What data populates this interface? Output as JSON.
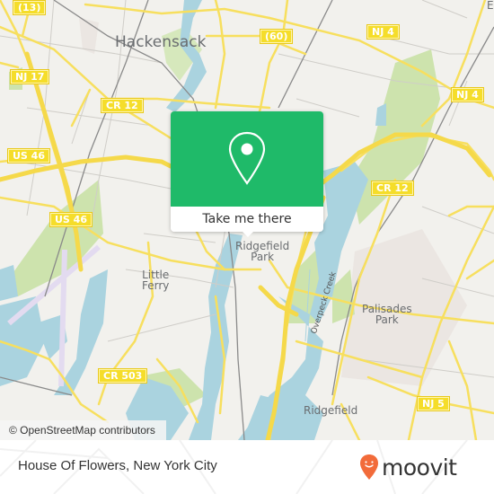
{
  "map": {
    "attribution": "© OpenStreetMap contributors",
    "colors": {
      "land": "#f2f1ed",
      "water": "#aad3df",
      "park": "#c8e0a8",
      "road_major": "#f7df5e",
      "road_minor": "#c9c7c2",
      "rail": "#888888",
      "airport": "#e6def0",
      "urban": "#e9e4e0"
    },
    "places": [
      {
        "name": "Hackensack"
      },
      {
        "name": "Little\nFerry"
      },
      {
        "name": "Ridgefield\nPark"
      },
      {
        "name": "Palisades\nPark"
      },
      {
        "name": "Ridgefield"
      },
      {
        "name": "E"
      }
    ],
    "waterway_label": "Overpeck Creek",
    "shields": [
      "(13)",
      "(60)",
      "NJ 4",
      "NJ 17",
      "CR 12",
      "NJ 4",
      "US 46",
      "CR 12",
      "US 46",
      "CR 503",
      "NJ 5"
    ]
  },
  "popup": {
    "button_label": "Take me there",
    "icon": "map-pin-icon",
    "color": "#1fba69"
  },
  "footer": {
    "place_title": "House Of Flowers, New York City",
    "brand": "moovit",
    "brand_color": "#f26b3a"
  }
}
